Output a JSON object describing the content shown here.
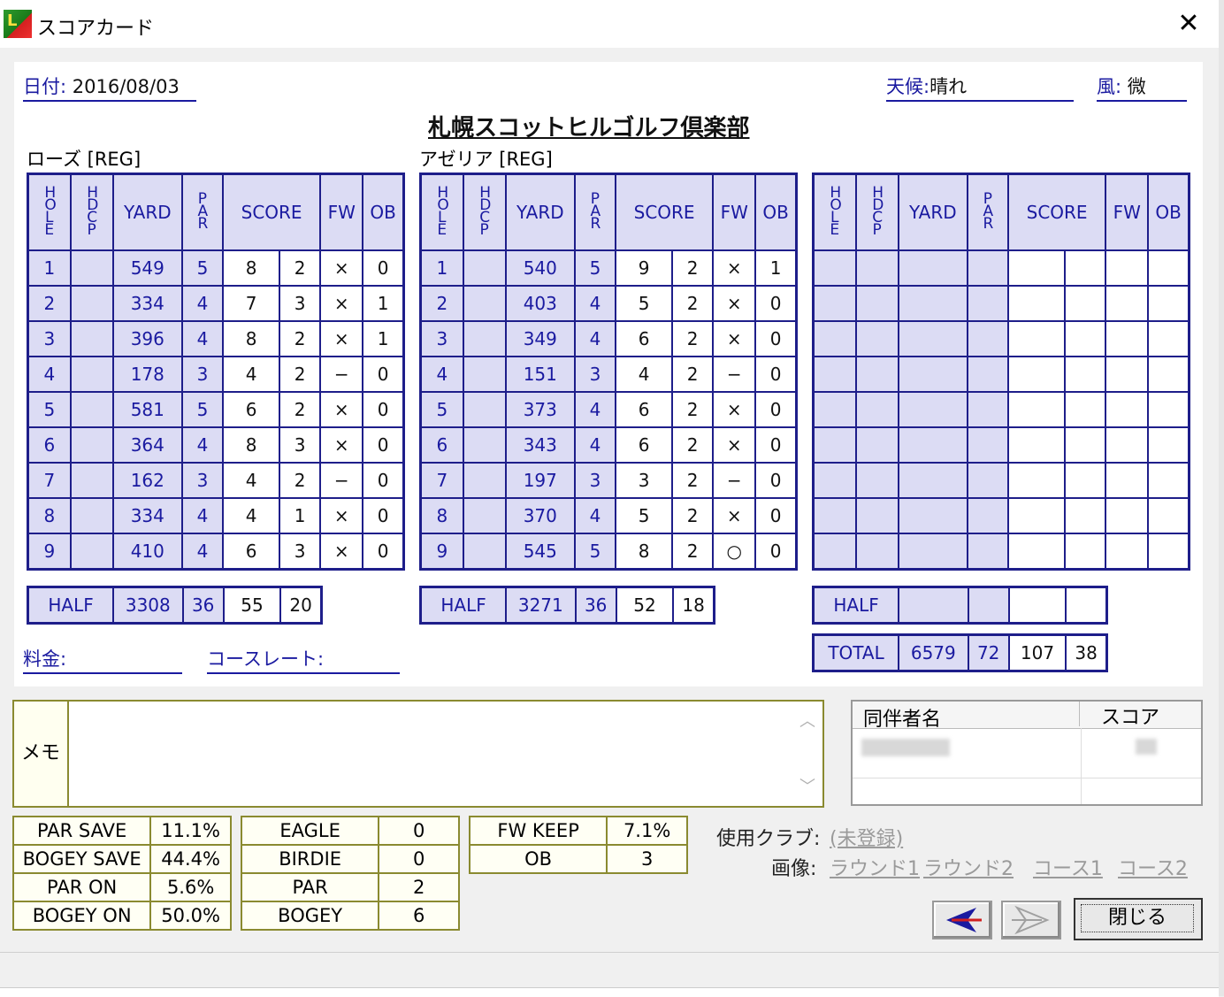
{
  "window": {
    "title": "スコアカード",
    "close": "✕"
  },
  "header": {
    "date_label": "日付:",
    "date": "2016/08/03",
    "weather_label": "天候:",
    "weather": "晴れ",
    "wind_label": "風:",
    "wind": "微",
    "club": "札幌スコットヒルゴルフ倶楽部"
  },
  "columns": {
    "hole": "HOLE",
    "hdcp": "HDCP",
    "yard": "YARD",
    "par": "PAR",
    "score": "SCORE",
    "fw": "FW",
    "ob": "OB"
  },
  "out": {
    "course": "ローズ [REG]",
    "holes": [
      {
        "hole": "1",
        "yard": "549",
        "par": "5",
        "score": "8",
        "putt": "2",
        "fw": "×",
        "ob": "0"
      },
      {
        "hole": "2",
        "yard": "334",
        "par": "4",
        "score": "7",
        "putt": "3",
        "fw": "×",
        "ob": "1"
      },
      {
        "hole": "3",
        "yard": "396",
        "par": "4",
        "score": "8",
        "putt": "2",
        "fw": "×",
        "ob": "1"
      },
      {
        "hole": "4",
        "yard": "178",
        "par": "3",
        "score": "4",
        "putt": "2",
        "fw": "−",
        "ob": "0"
      },
      {
        "hole": "5",
        "yard": "581",
        "par": "5",
        "score": "6",
        "putt": "2",
        "fw": "×",
        "ob": "0"
      },
      {
        "hole": "6",
        "yard": "364",
        "par": "4",
        "score": "8",
        "putt": "3",
        "fw": "×",
        "ob": "0"
      },
      {
        "hole": "7",
        "yard": "162",
        "par": "3",
        "score": "4",
        "putt": "2",
        "fw": "−",
        "ob": "0"
      },
      {
        "hole": "8",
        "yard": "334",
        "par": "4",
        "score": "4",
        "putt": "1",
        "fw": "×",
        "ob": "0"
      },
      {
        "hole": "9",
        "yard": "410",
        "par": "4",
        "score": "6",
        "putt": "3",
        "fw": "×",
        "ob": "0"
      }
    ],
    "half": {
      "label": "HALF",
      "yard": "3308",
      "par": "36",
      "score": "55",
      "putt": "20"
    }
  },
  "in": {
    "course": "アゼリア [REG]",
    "holes": [
      {
        "hole": "1",
        "yard": "540",
        "par": "5",
        "score": "9",
        "putt": "2",
        "fw": "×",
        "ob": "1"
      },
      {
        "hole": "2",
        "yard": "403",
        "par": "4",
        "score": "5",
        "putt": "2",
        "fw": "×",
        "ob": "0"
      },
      {
        "hole": "3",
        "yard": "349",
        "par": "4",
        "score": "6",
        "putt": "2",
        "fw": "×",
        "ob": "0"
      },
      {
        "hole": "4",
        "yard": "151",
        "par": "3",
        "score": "4",
        "putt": "2",
        "fw": "−",
        "ob": "0"
      },
      {
        "hole": "5",
        "yard": "373",
        "par": "4",
        "score": "6",
        "putt": "2",
        "fw": "×",
        "ob": "0"
      },
      {
        "hole": "6",
        "yard": "343",
        "par": "4",
        "score": "6",
        "putt": "2",
        "fw": "×",
        "ob": "0"
      },
      {
        "hole": "7",
        "yard": "197",
        "par": "3",
        "score": "3",
        "putt": "2",
        "fw": "−",
        "ob": "0"
      },
      {
        "hole": "8",
        "yard": "370",
        "par": "4",
        "score": "5",
        "putt": "2",
        "fw": "×",
        "ob": "0"
      },
      {
        "hole": "9",
        "yard": "545",
        "par": "5",
        "score": "8",
        "putt": "2",
        "fw": "○",
        "ob": "0"
      }
    ],
    "half": {
      "label": "HALF",
      "yard": "3271",
      "par": "36",
      "score": "52",
      "putt": "18"
    }
  },
  "third": {
    "half_label": "HALF"
  },
  "total": {
    "label": "TOTAL",
    "yard": "6579",
    "par": "72",
    "score": "107",
    "putt": "38"
  },
  "fees": {
    "fee_label": "料金:",
    "rate_label": "コースレート:"
  },
  "memo": {
    "label": "メモ"
  },
  "companions": {
    "name_header": "同伴者名",
    "score_header": "スコア"
  },
  "stats1": [
    [
      "PAR SAVE",
      "11.1%"
    ],
    [
      "BOGEY SAVE",
      "44.4%"
    ],
    [
      "PAR ON",
      "5.6%"
    ],
    [
      "BOGEY ON",
      "50.0%"
    ]
  ],
  "stats2": [
    [
      "EAGLE",
      "0"
    ],
    [
      "BIRDIE",
      "0"
    ],
    [
      "PAR",
      "2"
    ],
    [
      "BOGEY",
      "6"
    ]
  ],
  "stats3": [
    [
      "FW KEEP",
      "7.1%"
    ],
    [
      "OB",
      "3"
    ]
  ],
  "clubs": {
    "label": "使用クラブ:",
    "value": "(未登録)"
  },
  "images": {
    "label": "画像:",
    "links": [
      "ラウンド1",
      "ラウンド2",
      "コース1",
      "コース2"
    ]
  },
  "buttons": {
    "close": "閉じる"
  }
}
